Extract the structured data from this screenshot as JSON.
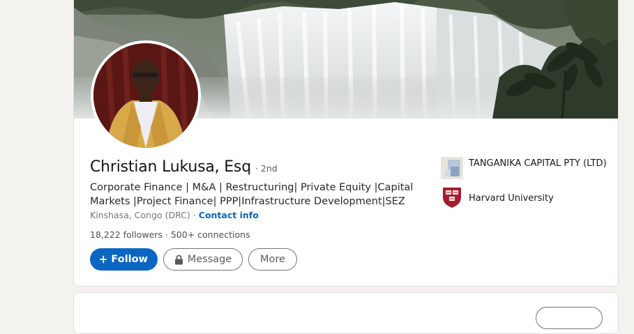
{
  "profile": {
    "name": "Christian Lukusa, Esq",
    "degree": "· 2nd",
    "headline": "Corporate Finance | M&A | Restructuring| Private Equity |Capital Markets |Project Finance| PPP|Infrastructure Development|SEZ",
    "location": "Kinshasa, Congo (DRC)",
    "separator": " · ",
    "contact_info": "Contact info",
    "followers": "18,222 followers",
    "dot": " · ",
    "connections": "500+ connections"
  },
  "actions": {
    "follow_label": "Follow",
    "message_label": "Message",
    "more_label": "More"
  },
  "organizations": [
    {
      "name": "TANGANIKA CAPITAL PTY (LTD)",
      "logo": "company-logo-icon"
    },
    {
      "name": "Harvard University",
      "logo": "harvard-shield-icon"
    }
  ],
  "colors": {
    "primary": "#0a66c2",
    "background": "#f3f2ef",
    "harvard_crimson": "#a51c30"
  }
}
